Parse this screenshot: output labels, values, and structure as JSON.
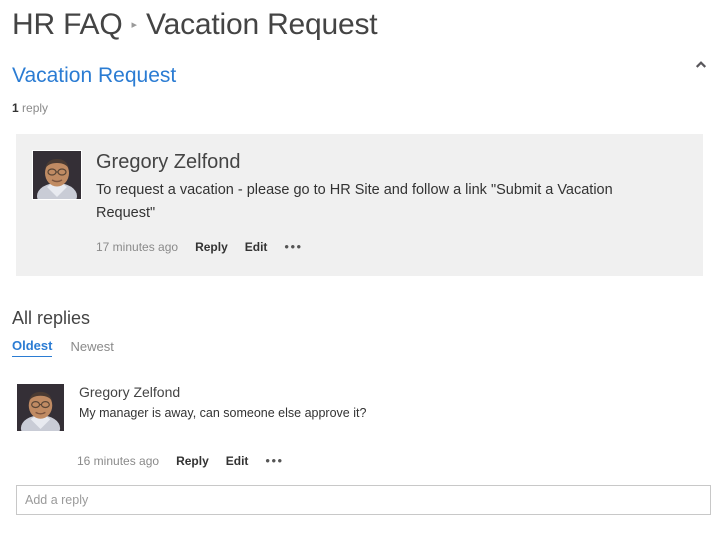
{
  "breadcrumb": {
    "parent": "HR FAQ",
    "separator": "▸",
    "current": "Vacation Request"
  },
  "thread": {
    "title": "Vacation Request",
    "reply_count_number": "1",
    "reply_count_label": " reply",
    "collapse_icon": "chevron-up-icon"
  },
  "main_post": {
    "author": "Gregory Zelfond",
    "body": "To request a vacation - please go to HR Site and follow a link \"Submit a Vacation Request\"",
    "timestamp": "17 minutes ago",
    "reply_action": "Reply",
    "edit_action": "Edit",
    "more_action": "•••",
    "avatar_alt": "user-avatar"
  },
  "replies_section": {
    "heading": "All replies",
    "sort_tabs": [
      {
        "label": "Oldest",
        "active": true
      },
      {
        "label": "Newest",
        "active": false
      }
    ]
  },
  "replies": [
    {
      "author": "Gregory Zelfond",
      "body": "My manager is away, can someone else approve it?",
      "timestamp": "16 minutes ago",
      "reply_action": "Reply",
      "edit_action": "Edit",
      "more_action": "•••",
      "avatar_alt": "user-avatar"
    }
  ],
  "add_reply": {
    "placeholder": "Add a reply",
    "value": ""
  },
  "colors": {
    "accent_blue": "#2b7cd3",
    "panel_gray": "#f0f0f0",
    "text_dark": "#333333",
    "text_muted": "#8a8a8a"
  }
}
